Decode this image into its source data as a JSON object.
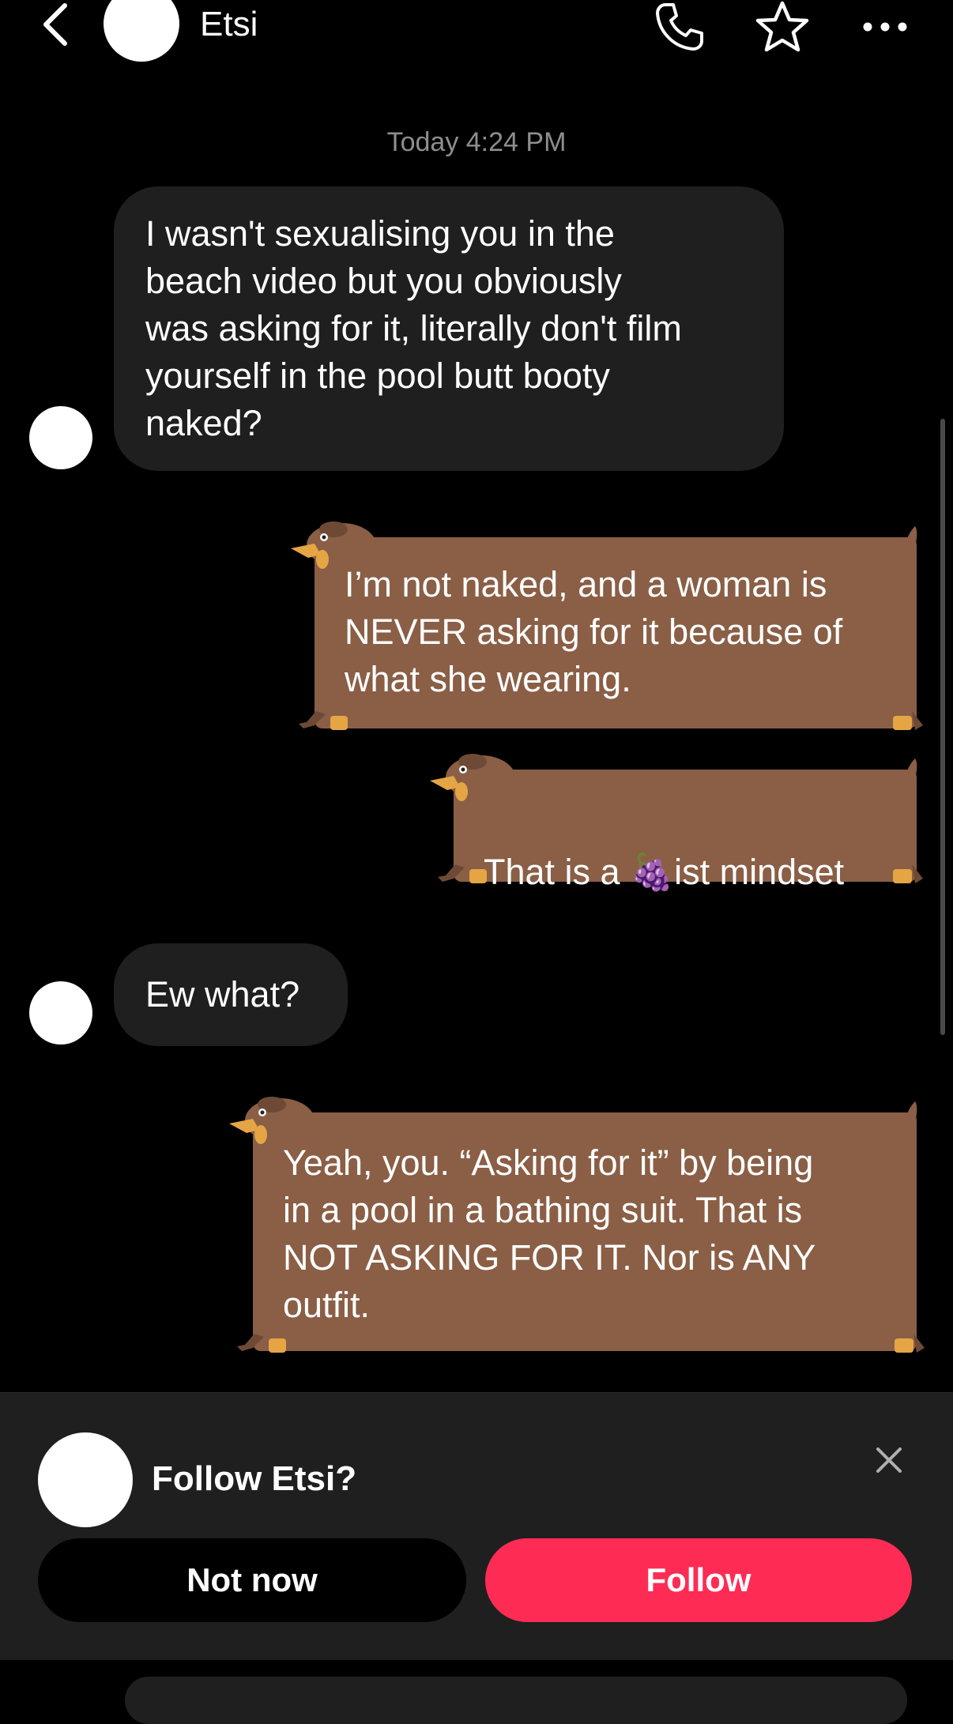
{
  "header": {
    "contact_name": "Etsi"
  },
  "timestamp": "Today 4:24 PM",
  "messages": [
    {
      "from": "them",
      "text": "I wasn't sexualising you in the\nbeach video but you obviously\nwas asking for it, literally don't film\nyourself in the pool butt booty\nnaked?"
    },
    {
      "from": "me",
      "text": "I’m not naked, and a woman is\nNEVER asking for it because of\nwhat she wearing."
    },
    {
      "from": "me",
      "text_before": "That is a ",
      "emoji": "🍇",
      "text_after": "ist mindset"
    },
    {
      "from": "them",
      "text": "Ew what?"
    },
    {
      "from": "me",
      "text": "Yeah, you. “Asking for it” by being\nin a pool in a bathing suit. That is\nNOT ASKING FOR IT. Nor is ANY\noutfit."
    }
  ],
  "follow_prompt": {
    "question": "Follow Etsi?",
    "not_now_label": "Not now",
    "follow_label": "Follow"
  },
  "colors": {
    "background": "#000000",
    "incoming_bubble": "#1f1f1f",
    "dog_bubble": "#8a5f46",
    "follow_button": "#fe2c55",
    "timestamp": "#8e8e8e"
  },
  "icons": [
    "back-chevron-icon",
    "phone-icon",
    "star-icon",
    "more-icon",
    "close-icon"
  ]
}
